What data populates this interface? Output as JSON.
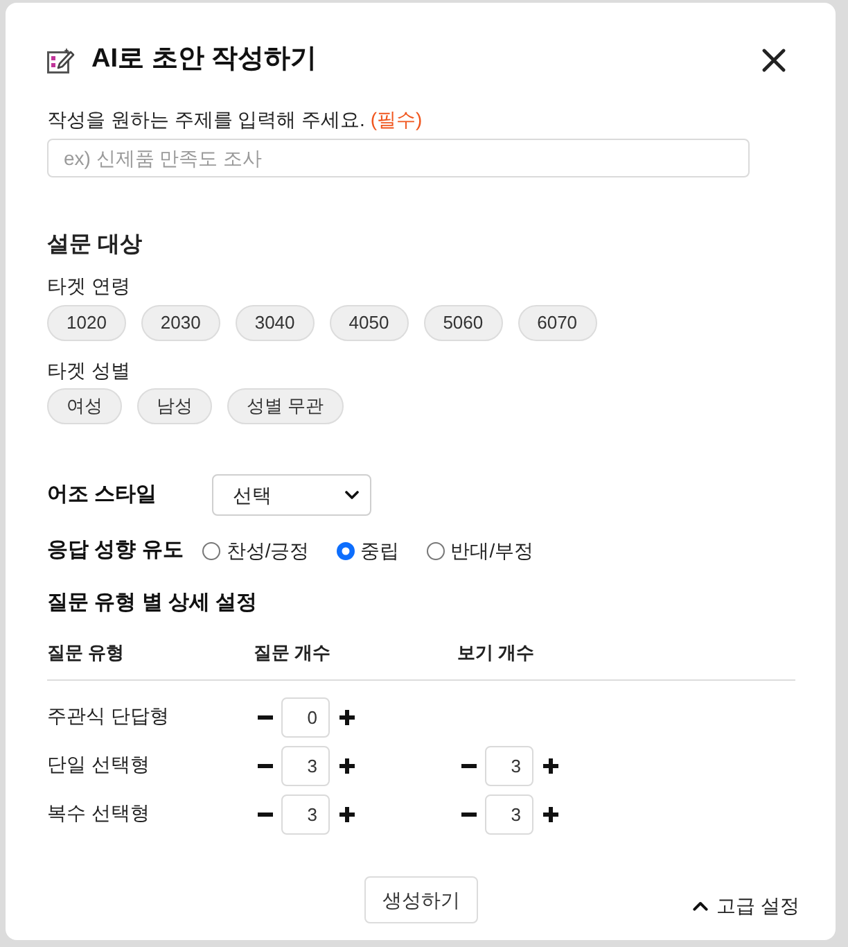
{
  "dialog": {
    "title": "AI로 초안 작성하기"
  },
  "topic": {
    "label": "작성을 원하는 주제를 입력해 주세요.",
    "required_mark": "(필수)",
    "placeholder": "ex) 신제품 만족도 조사"
  },
  "audience": {
    "title": "설문 대상",
    "age": {
      "label": "타겟 연령",
      "options": [
        {
          "label": "1020",
          "selected": false
        },
        {
          "label": "2030",
          "selected": false
        },
        {
          "label": "3040",
          "selected": false
        },
        {
          "label": "4050",
          "selected": false
        },
        {
          "label": "5060",
          "selected": false
        },
        {
          "label": "6070",
          "selected": false
        }
      ]
    },
    "gender": {
      "label": "타겟 성별",
      "options": [
        {
          "label": "여성",
          "selected": false
        },
        {
          "label": "남성",
          "selected": false
        },
        {
          "label": "성별 무관",
          "selected": false
        }
      ]
    }
  },
  "tone": {
    "label": "어조 스타일",
    "value": "선택"
  },
  "response_bias": {
    "label": "응답 성향 유도",
    "options": [
      {
        "label": "찬성/긍정",
        "selected": false
      },
      {
        "label": "중립",
        "selected": true
      },
      {
        "label": "반대/부정",
        "selected": false
      }
    ]
  },
  "question_settings": {
    "title": "질문 유형 별 상세 설정",
    "columns": [
      "질문 유형",
      "질문 개수",
      "보기 개수"
    ],
    "rows": [
      {
        "label": "주관식 단답형",
        "question_count": "0"
      },
      {
        "label": "단일 선택형",
        "question_count": "3",
        "option_count": "3"
      },
      {
        "label": "복수 선택형",
        "question_count": "3",
        "option_count": "3"
      }
    ]
  },
  "footer": {
    "generate_button": "생성하기",
    "advanced": {
      "label": "고급 설정",
      "expanded": true
    }
  }
}
